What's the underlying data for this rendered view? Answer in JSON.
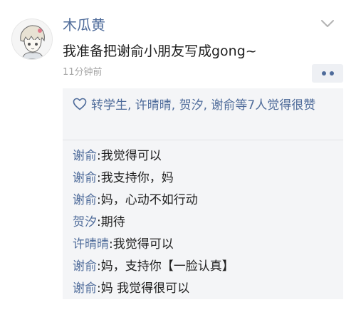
{
  "post": {
    "username": "木瓜黄",
    "content": "我准备把谢俞小朋友写成gong~",
    "time": "11分钟前"
  },
  "likes": {
    "text": "转学生, 许晴晴, 贺汐, 谢俞等7人觉得很赞",
    "icon": "heart-outline-icon",
    "color": "#4e6b9a"
  },
  "comments": [
    {
      "name": "谢俞",
      "sep": ":",
      "text": "我觉得可以"
    },
    {
      "name": "谢俞",
      "sep": ":",
      "text": "我支持你，妈"
    },
    {
      "name": "谢俞",
      "sep": ":",
      "text": "妈，心动不如行动"
    },
    {
      "name": "贺汐",
      "sep": ":",
      "text": "期待"
    },
    {
      "name": "许晴晴",
      "sep": ":",
      "text": "我觉得可以"
    },
    {
      "name": "谢俞",
      "sep": ":",
      "text": "妈，支持你【一脸认真】"
    },
    {
      "name": "谢俞",
      "sep": ":",
      "text": "妈 我觉得很可以"
    }
  ],
  "colors": {
    "link": "#4e6b9a",
    "panel": "#f4f5f7",
    "time": "#a5a5a5"
  }
}
